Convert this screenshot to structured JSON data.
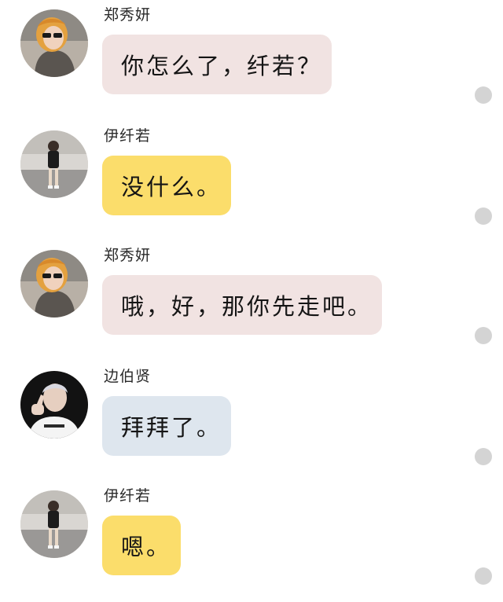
{
  "theme": {
    "pink_bubble": "#f1e3e2",
    "yellow_bubble": "#fbdd6b",
    "blue_bubble": "#dee6ee",
    "status_dot": "#d4d4d4"
  },
  "messages": [
    {
      "sender": "郑秀妍",
      "text": "你怎么了，纤若？",
      "bubble_color": "pink",
      "avatar_icon": "woman-sunglasses-avatar-icon"
    },
    {
      "sender": "伊纤若",
      "text": "没什么。",
      "bubble_color": "yellow",
      "avatar_icon": "woman-standing-avatar-icon"
    },
    {
      "sender": "郑秀妍",
      "text": "哦，好，那你先走吧。",
      "bubble_color": "pink",
      "avatar_icon": "woman-sunglasses-avatar-icon"
    },
    {
      "sender": "边伯贤",
      "text": "拜拜了。",
      "bubble_color": "blue",
      "avatar_icon": "man-waving-avatar-icon"
    },
    {
      "sender": "伊纤若",
      "text": "嗯。",
      "bubble_color": "yellow",
      "avatar_icon": "woman-standing-avatar-icon"
    }
  ]
}
